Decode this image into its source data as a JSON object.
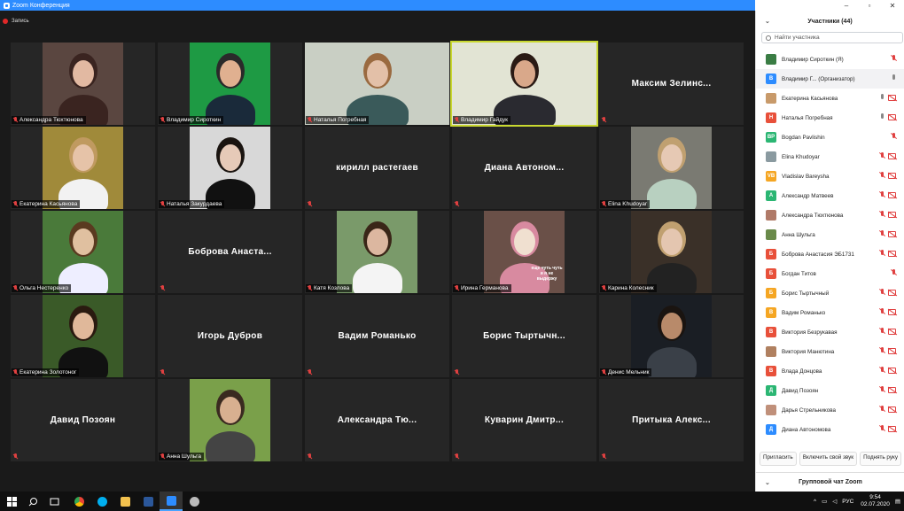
{
  "window": {
    "title": "Zoom Конференция",
    "controls": [
      "–",
      "▫",
      "✕"
    ]
  },
  "recording": {
    "label": "Запись"
  },
  "tiles": [
    {
      "name": "Александра Тюхтюнова",
      "video": true
    },
    {
      "name": "Владимир Сироткин",
      "video": true
    },
    {
      "name": "Наталья Погребная",
      "video": true
    },
    {
      "name": "Владимир Гайдук",
      "video": true,
      "active": true
    },
    {
      "name": "",
      "display": "Максим Зелинс...",
      "video": false
    },
    {
      "name": "Екатерина Касьянова",
      "video": true
    },
    {
      "name": "Наталья Закурдаева",
      "video": true
    },
    {
      "name": "",
      "display": "кирилл растегаев",
      "video": false
    },
    {
      "name": "",
      "display": "Диана Автоном...",
      "video": false
    },
    {
      "name": "Elina Khudoyar",
      "video": true
    },
    {
      "name": "Ольга Нестеренко",
      "video": true
    },
    {
      "name": "",
      "display": "Боброва Анаста...",
      "video": false
    },
    {
      "name": "Катя Козлова",
      "video": true
    },
    {
      "name": "Ирина Германова",
      "video": true,
      "caption": "еще чуть чуть и я не выдержу"
    },
    {
      "name": "Карина Колесник",
      "video": true
    },
    {
      "name": "Екатерина Золотоног",
      "video": true
    },
    {
      "name": "",
      "display": "Игорь Дубров",
      "video": false
    },
    {
      "name": "",
      "display": "Вадим Романько",
      "video": false
    },
    {
      "name": "",
      "display": "Борис Тыртычн...",
      "video": false
    },
    {
      "name": "Денис Мельник",
      "video": true
    },
    {
      "name": "",
      "display": "Давид Позоян",
      "video": false
    },
    {
      "name": "Анна Шульга",
      "video": true
    },
    {
      "name": "",
      "display": "Александра Тю...",
      "video": false
    },
    {
      "name": "",
      "display": "Куварин Дмитр...",
      "video": false
    },
    {
      "name": "",
      "display": "Притыка Алекс...",
      "video": false
    }
  ],
  "panel": {
    "title": "Участники (44)",
    "search_placeholder": "Найти участника",
    "participants": [
      {
        "name": "Владимир Сироткин (Я)",
        "avatar": "",
        "color": "#3a7d44",
        "mic": "off",
        "cam": false
      },
      {
        "name": "Владимир Г... (Организатор)",
        "avatar": "В",
        "color": "#2d8cff",
        "mic": "on",
        "cam": false,
        "highlight": true
      },
      {
        "name": "Екатерина Касьянова",
        "avatar": "",
        "color": "#c89a6a",
        "mic": "on",
        "cam": true
      },
      {
        "name": "Наталья Погребная",
        "avatar": "Н",
        "color": "#e8503a",
        "mic": "on",
        "cam": true
      },
      {
        "name": "Bogdan Pavlishin",
        "avatar": "BP",
        "color": "#2bb673",
        "mic": "off",
        "cam": false
      },
      {
        "name": "Elina Khudoyar",
        "avatar": "",
        "color": "#8a9aa0",
        "mic": "off",
        "cam": true
      },
      {
        "name": "Vladislav Bareysha",
        "avatar": "VB",
        "color": "#f5a623",
        "mic": "off",
        "cam": true
      },
      {
        "name": "Александр Матвеев",
        "avatar": "А",
        "color": "#2bb673",
        "mic": "off",
        "cam": true
      },
      {
        "name": "Александра Тюхтюнова",
        "avatar": "",
        "color": "#b07a68",
        "mic": "off",
        "cam": true
      },
      {
        "name": "Анна Шульга",
        "avatar": "",
        "color": "#6a8a4a",
        "mic": "off",
        "cam": true
      },
      {
        "name": "Боброва Анастасия ЭБ1731",
        "avatar": "Б",
        "color": "#e8503a",
        "mic": "off",
        "cam": true
      },
      {
        "name": "Богдан Титов",
        "avatar": "Б",
        "color": "#e8503a",
        "mic": "off",
        "cam": false
      },
      {
        "name": "Борис Тыртычный",
        "avatar": "Б",
        "color": "#f5a623",
        "mic": "off",
        "cam": true
      },
      {
        "name": "Вадим Романько",
        "avatar": "В",
        "color": "#f5a623",
        "mic": "off",
        "cam": true
      },
      {
        "name": "Виктория Безрукавая",
        "avatar": "В",
        "color": "#e8503a",
        "mic": "off",
        "cam": true
      },
      {
        "name": "Виктория Манютина",
        "avatar": "",
        "color": "#b08060",
        "mic": "off",
        "cam": true
      },
      {
        "name": "Влада Донцова",
        "avatar": "В",
        "color": "#e8503a",
        "mic": "off",
        "cam": true
      },
      {
        "name": "Давид Позоян",
        "avatar": "Д",
        "color": "#2bb673",
        "mic": "off",
        "cam": true
      },
      {
        "name": "Дарья Стрельникова",
        "avatar": "",
        "color": "#c0907a",
        "mic": "off",
        "cam": true
      },
      {
        "name": "Диана Автономова",
        "avatar": "Д",
        "color": "#2d8cff",
        "mic": "off",
        "cam": true
      }
    ],
    "buttons": {
      "invite": "Пригласить",
      "unmute": "Включить свой звук",
      "raise_hand": "Поднять руку"
    },
    "chat_title": "Групповой чат Zoom"
  },
  "taskbar": {
    "apps": [
      "start",
      "search",
      "task-view",
      "chrome",
      "skype",
      "explorer",
      "word",
      "zoom",
      "paint"
    ],
    "lang": "РУС",
    "time": "9:54",
    "date": "02.07.2020"
  },
  "colors": {
    "zoom_blue": "#2d8cff",
    "active_speaker": "#c9d830",
    "muted_red": "#e04040"
  }
}
